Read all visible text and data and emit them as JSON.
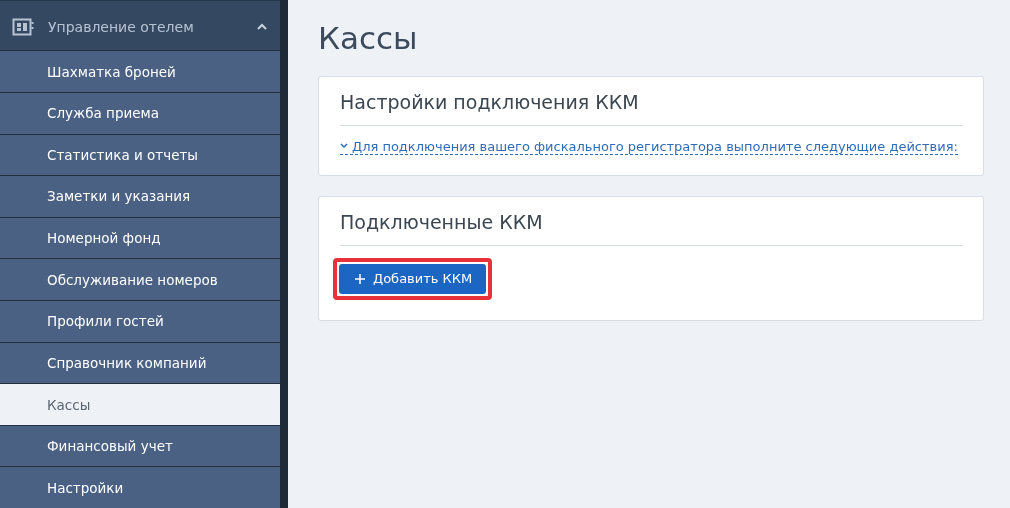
{
  "sidebar": {
    "section": {
      "label": "Управление отелем",
      "expanded": true
    },
    "items": [
      {
        "label": "Шахматка броней",
        "selected": false
      },
      {
        "label": "Служба приема",
        "selected": false
      },
      {
        "label": "Статистика и отчеты",
        "selected": false
      },
      {
        "label": "Заметки и указания",
        "selected": false
      },
      {
        "label": "Номерной фонд",
        "selected": false
      },
      {
        "label": "Обслуживание номеров",
        "selected": false
      },
      {
        "label": "Профили гостей",
        "selected": false
      },
      {
        "label": "Справочник компаний",
        "selected": false
      },
      {
        "label": "Кассы",
        "selected": true
      },
      {
        "label": "Финансовый учет",
        "selected": false
      },
      {
        "label": "Настройки",
        "selected": false
      }
    ]
  },
  "page": {
    "title": "Кассы",
    "cards": [
      {
        "title": "Настройки подключения ККМ",
        "kind": "link",
        "link": "Для подключения вашего фискального регистратора выполните следующие действия:"
      },
      {
        "title": "Подключенные ККМ",
        "kind": "button",
        "button": {
          "label": "Добавить ККМ",
          "highlighted": true
        }
      }
    ]
  }
}
